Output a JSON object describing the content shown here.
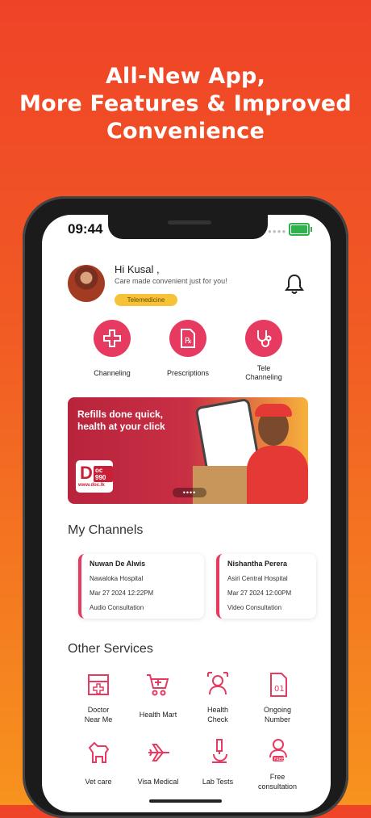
{
  "headline": [
    "All-New App,",
    "More Features & Improved",
    "Convenience"
  ],
  "status_bar": {
    "time": "09:44"
  },
  "greeting": {
    "name": "Hi Kusal  ,",
    "subtitle": "Care made convenient just for you!",
    "badge": "Telemedicine"
  },
  "quick_services": [
    {
      "label": "Channeling",
      "icon": "plus-icon"
    },
    {
      "label": "Prescriptions",
      "icon": "prescription-icon"
    },
    {
      "label": "Tele\nChanneling",
      "icon": "stethoscope-icon"
    }
  ],
  "banner": {
    "line1": "Refills done quick,",
    "line2": "health at your click",
    "logo_main": "D",
    "logo_side": "oc 990",
    "logo_web": "www.doc.lk",
    "dots": "••••"
  },
  "my_channels": {
    "title": "My Channels",
    "cards": [
      {
        "doctor": "Nuwan De Alwis",
        "hospital": "Nawaloka Hospital",
        "datetime": "Mar 27 2024 12:22PM",
        "type": "Audio Consultation"
      },
      {
        "doctor": "Nishantha Perera",
        "hospital": "Asiri Central Hospital",
        "datetime": "Mar 27 2024 12:00PM",
        "type": "Video Consultation"
      }
    ]
  },
  "other_services": {
    "title": "Other Services",
    "items": [
      {
        "label": "Doctor\nNear Me",
        "icon": "clinic-icon"
      },
      {
        "label": "Health Mart",
        "icon": "cart-icon"
      },
      {
        "label": "Health\nCheck",
        "icon": "health-check-icon"
      },
      {
        "label": "Ongoing\nNumber",
        "icon": "number-card-icon"
      },
      {
        "label": "Vet care",
        "icon": "dog-icon"
      },
      {
        "label": "Visa Medical",
        "icon": "plane-icon"
      },
      {
        "label": "Lab Tests",
        "icon": "microscope-icon"
      },
      {
        "label": "Free\nconsultation",
        "icon": "doctor-free-icon"
      }
    ]
  },
  "colors": {
    "accent": "#e63a60",
    "badge": "#f6c338",
    "background_top": "#ef4328",
    "background_bottom": "#f7931e"
  }
}
